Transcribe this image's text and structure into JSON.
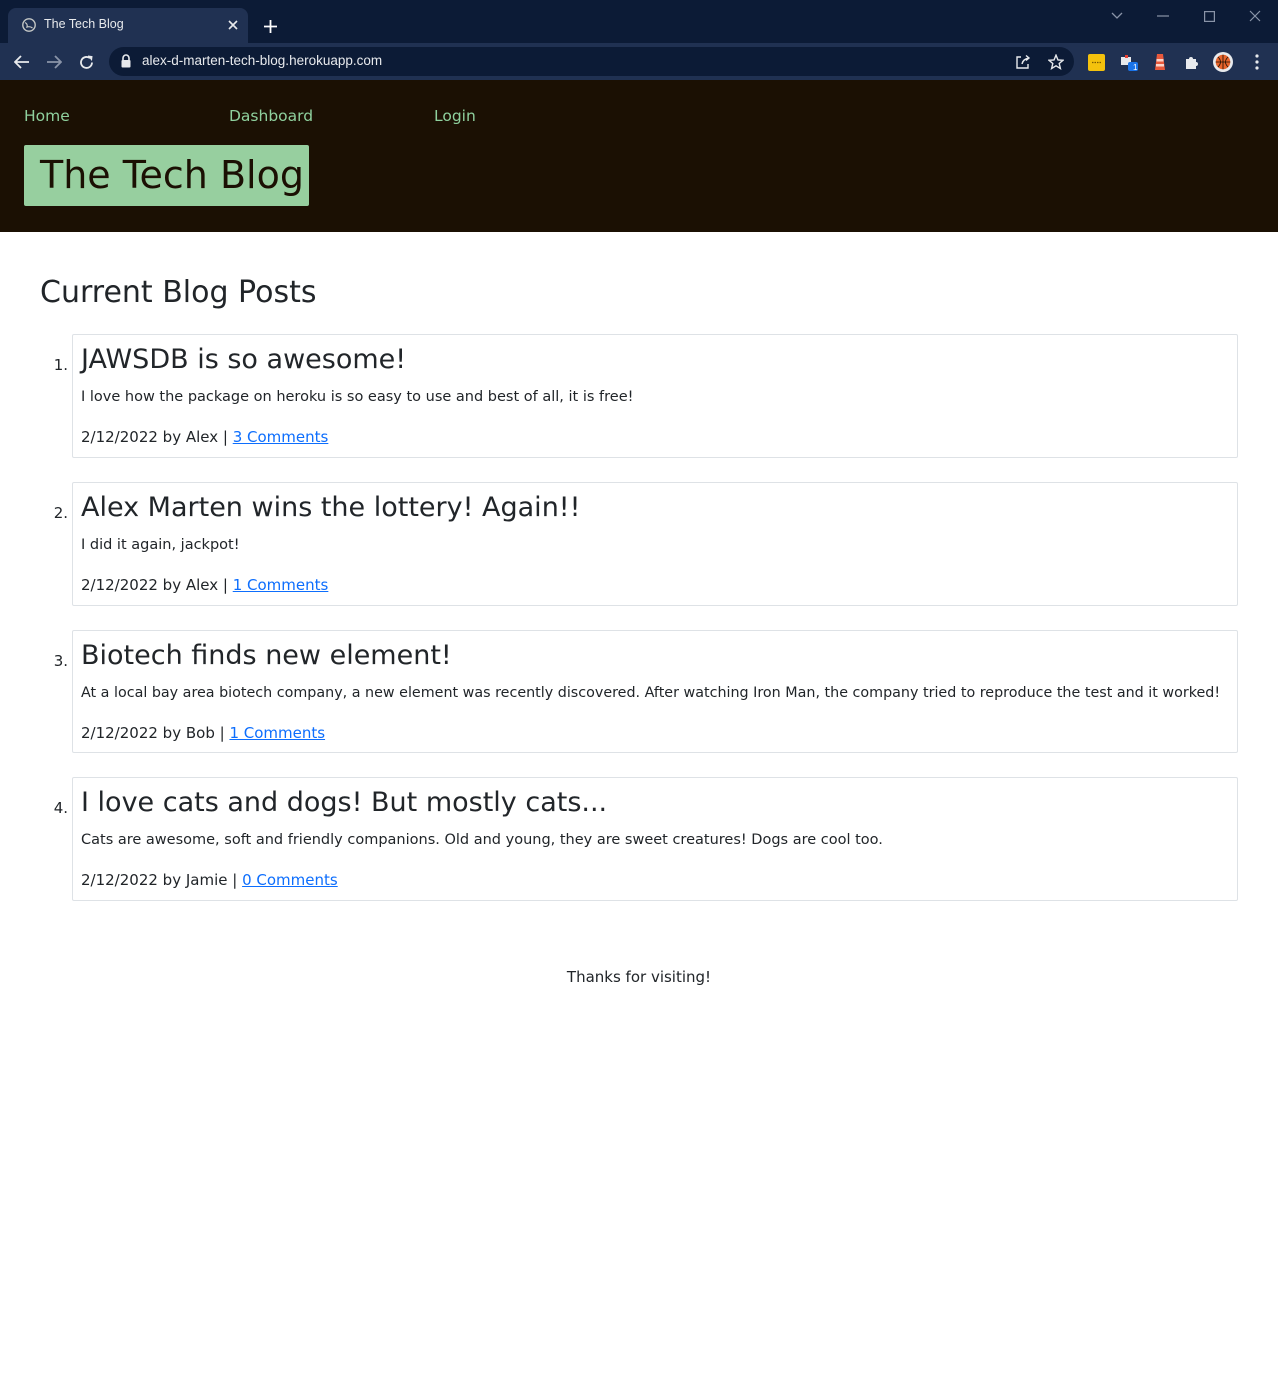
{
  "browser": {
    "tab_title": "The Tech Blog",
    "url": "alex-d-marten-tech-blog.herokuapp.com",
    "extension_badge": "1"
  },
  "nav": {
    "home": "Home",
    "dashboard": "Dashboard",
    "login": "Login"
  },
  "brand": {
    "title": "The Tech Blog"
  },
  "main": {
    "heading": "Current Blog Posts",
    "posts": [
      {
        "number": "1.",
        "title": "JAWSDB is so awesome!",
        "body": "I love how the package on heroku is so easy to use and best of all, it is free!",
        "meta": "2/12/2022 by Alex | ",
        "comments": "3 Comments"
      },
      {
        "number": "2.",
        "title": "Alex Marten wins the lottery! Again!!",
        "body": "I did it again, jackpot!",
        "meta": "2/12/2022 by Alex | ",
        "comments": "1 Comments"
      },
      {
        "number": "3.",
        "title": "Biotech finds new element!",
        "body": "At a local bay area biotech company, a new element was recently discovered. After watching Iron Man, the company tried to reproduce the test and it worked!",
        "meta": "2/12/2022 by Bob | ",
        "comments": "1 Comments"
      },
      {
        "number": "4.",
        "title": "I love cats and dogs! But mostly cats...",
        "body": "Cats are awesome, soft and friendly companions. Old and young, they are sweet creatures! Dogs are cool too.",
        "meta": "2/12/2022 by Jamie | ",
        "comments": "0 Comments"
      }
    ]
  },
  "footer": {
    "text": "Thanks for visiting!"
  },
  "colors": {
    "header_bg": "#1b1003",
    "brand_bg": "#97cf9f",
    "nav_link": "#8fd19e",
    "link": "#0d6efd"
  }
}
